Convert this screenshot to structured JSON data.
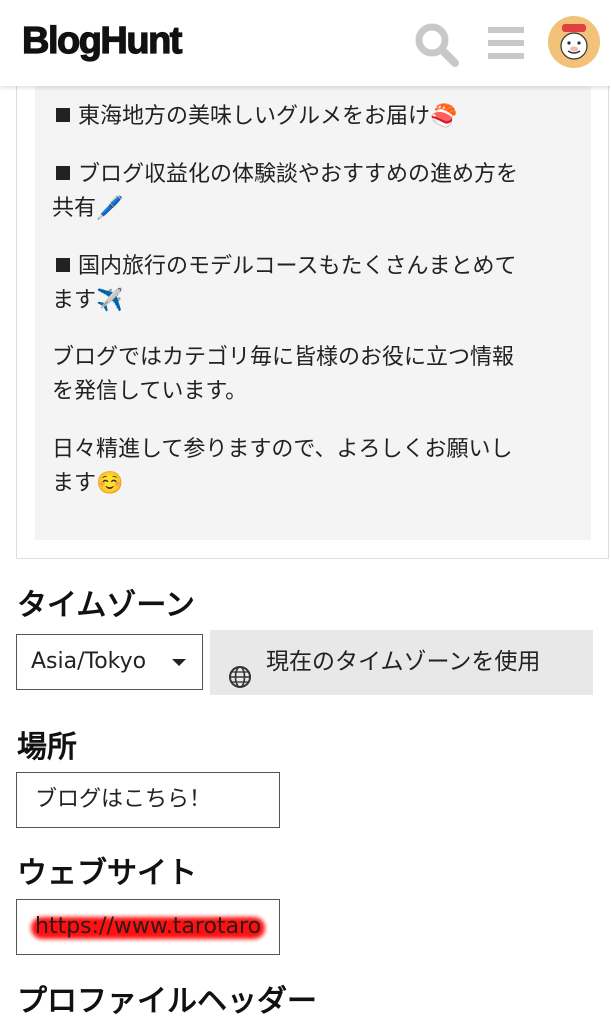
{
  "header": {
    "logo": "BlogHunt",
    "icons": {
      "search": "search-icon",
      "menu": "hamburger-menu-icon",
      "avatar": "user-avatar"
    }
  },
  "bio": {
    "line1": "東海地方の美味しいグルメをお届け🍣",
    "line2a": "ブログ収益化の体験談やおすすめの進め方を",
    "line2b": "共有🖊️",
    "line3a": "国内旅行のモデルコースもたくさんまとめて",
    "line3b": "ます✈️",
    "line4a": "ブログではカテゴリ毎に皆様のお役に立つ情報",
    "line4b": "を発信しています。",
    "line5a": "日々精進して参りますので、よろしくお願いし",
    "line5b": "ます☺️"
  },
  "timezone": {
    "title": "タイムゾーン",
    "selected": "Asia/Tokyo",
    "use_current_label": "現在のタイムゾーンを使用"
  },
  "location": {
    "title": "場所",
    "value": "ブログはこちら！"
  },
  "website": {
    "title": "ウェブサイト",
    "value": "https://www.tarotaro"
  },
  "profile_header": {
    "title": "プロファイルヘッダー"
  },
  "colors": {
    "redaction": "#ff1010",
    "field_border": "#555555",
    "button_bg": "#e8e8e8"
  }
}
